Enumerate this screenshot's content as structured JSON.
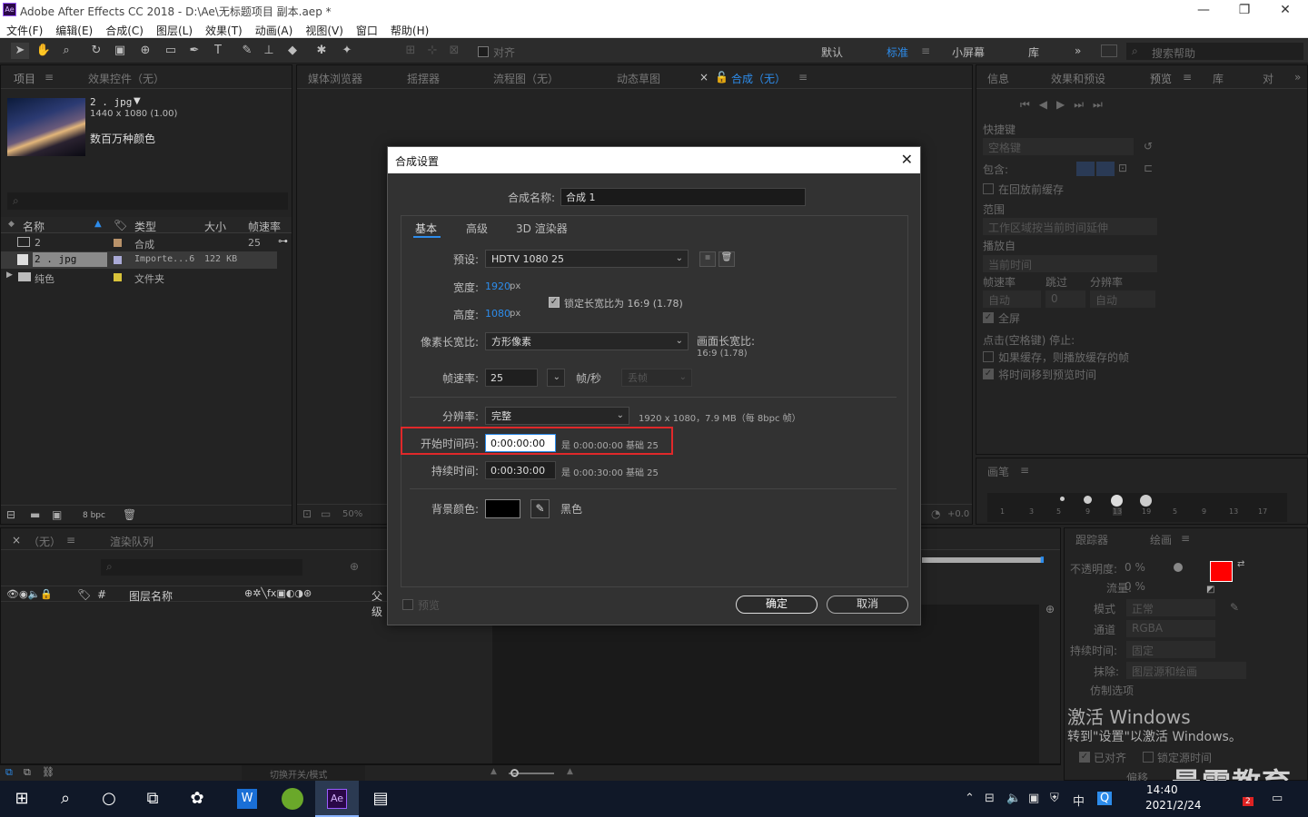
{
  "window": {
    "title": "Adobe After Effects CC 2018 - D:\\Ae\\无标题项目 副本.aep *",
    "app_logo": "Ae"
  },
  "menu": [
    "文件(F)",
    "编辑(E)",
    "合成(C)",
    "图层(L)",
    "效果(T)",
    "动画(A)",
    "视图(V)",
    "窗口",
    "帮助(H)"
  ],
  "toolbar": {
    "align_label": "对齐",
    "workspaces": [
      "默认",
      "标准",
      "小屏幕",
      "库"
    ],
    "active_workspace": "标准",
    "search_placeholder": "搜索帮助"
  },
  "project_panel": {
    "tabs": [
      "项目",
      "效果控件（无）"
    ],
    "thumb_name": "2 . jpg",
    "thumb_dims": "1440 x 1080 (1.00)",
    "thumb_colors": "数百万种颜色",
    "columns": [
      "名称",
      "类型",
      "大小",
      "帧速率"
    ],
    "rows": [
      {
        "name": "2",
        "type": "合成",
        "size": "",
        "fps": "25",
        "color": "#b8926a"
      },
      {
        "name": "2 . jpg",
        "type": "Importe...6",
        "size": "122 KB",
        "fps": "",
        "color": "#a9a9d6"
      },
      {
        "name": "纯色",
        "type": "文件夹",
        "size": "",
        "fps": "",
        "color": "#d9c33a"
      }
    ],
    "bpc": "8 bpc"
  },
  "center_tabs": [
    "媒体浏览器",
    "摇摆器",
    "流程图（无）",
    "动态草图",
    "合成（无）"
  ],
  "center_footer": {
    "zoom": "50%",
    "offset": "+0.0"
  },
  "right_panel": {
    "tabs": [
      "信息",
      "效果和预设",
      "预览",
      "库",
      "对"
    ],
    "shortcut_label": "快捷键",
    "shortcut_value": "空格键",
    "include_label": "包含:",
    "cache_before": "在回放前缓存",
    "range_label": "范围",
    "range_value": "工作区域按当前时间延伸",
    "play_from_label": "播放自",
    "play_from_value": "当前时间",
    "fps_label": "帧速率",
    "skip_label": "跳过",
    "res_label": "分辨率",
    "fps_value": "自动",
    "skip_value": "0",
    "res_value": "自动",
    "fullscreen": "全屏",
    "stop_label": "点击(空格键) 停止:",
    "cache_play": "如果缓存，则播放缓存的帧",
    "move_time": "将时间移到预览时间"
  },
  "brushes_panel": {
    "title": "画笔",
    "sizes": [
      "1",
      "3",
      "5",
      "9",
      "13",
      "19",
      "5",
      "9",
      "13",
      "17"
    ]
  },
  "timeline": {
    "tabs": [
      "（无）",
      "渲染队列"
    ],
    "layer_name_col": "图层名称",
    "parent_col": "父级",
    "toggle_label": "切换开关/模式"
  },
  "paint_panel": {
    "tabs": [
      "跟踪器",
      "绘画"
    ],
    "opacity_label": "不透明度:",
    "opacity_value": "0 %",
    "flow_label": "流量:",
    "flow_value": "0 %",
    "mode_label": "模式",
    "mode_value": "正常",
    "channel_label": "通道",
    "channel_value": "RGBA",
    "duration_label": "持续时间:",
    "duration_value": "固定",
    "erase_label": "抹除:",
    "erase_value": "图层源和绘画",
    "clone_label": "仿制选项",
    "aligned": "已对齐",
    "lock_source": "锁定源时间",
    "offset_label": "偏移",
    "fg_color": "#ff0000",
    "bg_color": "#ffffff"
  },
  "dialog": {
    "title": "合成设置",
    "comp_name_label": "合成名称:",
    "comp_name": "合成 1",
    "tabs": [
      "基本",
      "高级",
      "3D 渲染器"
    ],
    "preset_label": "预设:",
    "preset_value": "HDTV 1080 25",
    "width_label": "宽度:",
    "width_value": "1920",
    "width_unit": "px",
    "height_label": "高度:",
    "height_value": "1080",
    "height_unit": "px",
    "lock_aspect": "锁定长宽比为 16:9 (1.78)",
    "par_label": "像素长宽比:",
    "par_value": "方形像素",
    "frame_aspect_label": "画面长宽比:",
    "frame_aspect_value": "16:9 (1.78)",
    "fps_label": "帧速率:",
    "fps_value": "25",
    "fps_unit": "帧/秒",
    "drop_frame": "丢帧",
    "res_label": "分辨率:",
    "res_value": "完整",
    "res_info": "1920 x 1080，7.9 MB（每 8bpc 帧）",
    "start_tc_label": "开始时间码:",
    "start_tc_value": "0:00:00:00",
    "start_tc_info": "是 0:00:00:00  基础 25",
    "duration_label": "持续时间:",
    "duration_value": "0:00:30:00",
    "duration_info": "是 0:00:30:00  基础 25",
    "bg_label": "背景颜色:",
    "bg_name": "黑色",
    "bg_color": "#000000",
    "preview": "预览",
    "ok": "确定",
    "cancel": "取消",
    "highlight_color": "#e0282a"
  },
  "watermark": {
    "line1": "激活 Windows",
    "line2": "转到\"设置\"以激活 Windows。",
    "brand": "最需教育"
  },
  "taskbar": {
    "time": "14:40",
    "date": "2021/2/24",
    "ime": "中",
    "notifications": "2"
  }
}
